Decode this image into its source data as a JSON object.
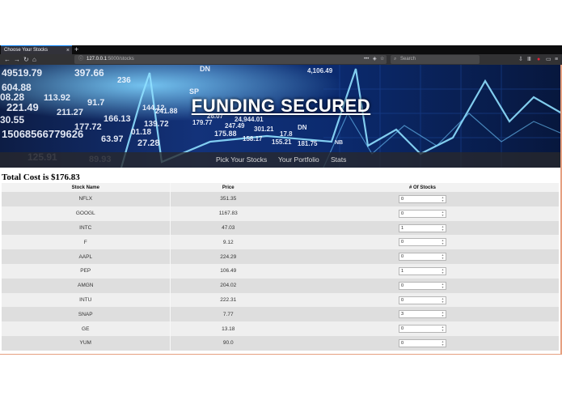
{
  "browser": {
    "tab_title": "Choose Your Stocks",
    "tab_close": "×",
    "new_tab": "+",
    "url_host": "127.0.0.1",
    "url_path": ":5000/stocks",
    "url_info_icon": "ⓘ",
    "more_icon": "•••",
    "pocket_icon": "◈",
    "bookmark_icon": "☆",
    "search_placeholder": "Search",
    "search_icon": "⌕",
    "back_icon": "←",
    "forward_icon": "→",
    "reload_icon": "↻",
    "home_icon": "⌂",
    "download_icon": "⇩",
    "library_icon": "Ⅲ",
    "extension_icon": "●",
    "sidebar_icon": "▭",
    "menu_icon": "≡",
    "extension_color": "#e0253a"
  },
  "hero": {
    "title": "FUNDING SECURED",
    "ticker_numbers": [
      "49519.79",
      "604.88",
      "08.28",
      "113.92",
      "91.7",
      "221.49",
      "211.27",
      "166.13",
      "30.55",
      "177.72",
      "15068566779626",
      "63.97",
      "27.28",
      "397.66",
      "236",
      "144.12",
      "241.88",
      "139.72",
      "179.77",
      "247.49",
      "301.21",
      "17.8",
      "158.17",
      "155.21",
      "181.75",
      "125.91",
      "89.93",
      "4,106.49",
      "24,944.01",
      "26.07",
      "01.18",
      "175.88",
      "DN",
      "NB",
      "SP",
      "DN"
    ]
  },
  "nav": {
    "links": [
      "Pick Your Stocks",
      "Your Portfolio",
      "Stats"
    ]
  },
  "total_label": "Total Cost is $176.83",
  "table": {
    "headers": [
      "Stock Name",
      "Price",
      "# Of Stocks"
    ],
    "rows": [
      {
        "name": "NFLX",
        "price": "351.35",
        "qty": "0"
      },
      {
        "name": "GOOGL",
        "price": "1167.83",
        "qty": "0"
      },
      {
        "name": "INTC",
        "price": "47.03",
        "qty": "1"
      },
      {
        "name": "F",
        "price": "9.12",
        "qty": "0"
      },
      {
        "name": "AAPL",
        "price": "224.29",
        "qty": "0"
      },
      {
        "name": "PEP",
        "price": "106.49",
        "qty": "1"
      },
      {
        "name": "AMGN",
        "price": "204.02",
        "qty": "0"
      },
      {
        "name": "INTU",
        "price": "222.31",
        "qty": "0"
      },
      {
        "name": "SNAP",
        "price": "7.77",
        "qty": "3"
      },
      {
        "name": "GE",
        "price": "13.18",
        "qty": "0"
      },
      {
        "name": "YUM",
        "price": "90.0",
        "qty": "0"
      }
    ],
    "spinner_up": "▲",
    "spinner_down": "▼"
  }
}
